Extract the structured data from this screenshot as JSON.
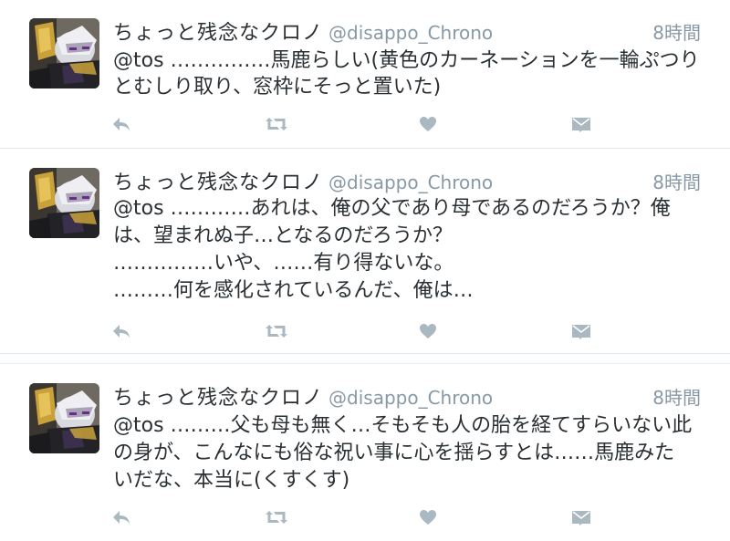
{
  "tweets": [
    {
      "display_name": "ちょっと残念なクロノ",
      "handle": "@disappo_Chrono",
      "time": "8時間",
      "lines": [
        "@tos ……………馬鹿らしい(黄色のカーネーションを一輪ぷつり",
        "とむしり取り、窓枠にそっと置いた)"
      ]
    },
    {
      "display_name": "ちょっと残念なクロノ",
      "handle": "@disappo_Chrono",
      "time": "8時間",
      "lines": [
        "@tos …………あれは、俺の父であり母であるのだろうか？俺",
        "は、望まれぬ子…となるのだろうか？",
        "……………いや、……有り得ないな。",
        "………何を感化されているんだ、俺は…"
      ]
    },
    {
      "display_name": "ちょっと残念なクロノ",
      "handle": "@disappo_Chrono",
      "time": "8時間",
      "lines": [
        "@tos ………父も母も無く…そもそも人の胎を経てすらいない此",
        "の身が、こんなにも俗な祝い事に心を揺らすとは……馬鹿みた",
        "いだな、本当に(くすくす)"
      ]
    }
  ],
  "icons": {
    "reply": "reply-icon",
    "retweet": "retweet-icon",
    "like": "heart-icon",
    "dm": "envelope-icon"
  },
  "colors": {
    "text": "#292f33",
    "meta": "#8899a6",
    "icon": "#aab8c2",
    "divider": "#e1e8ed"
  }
}
